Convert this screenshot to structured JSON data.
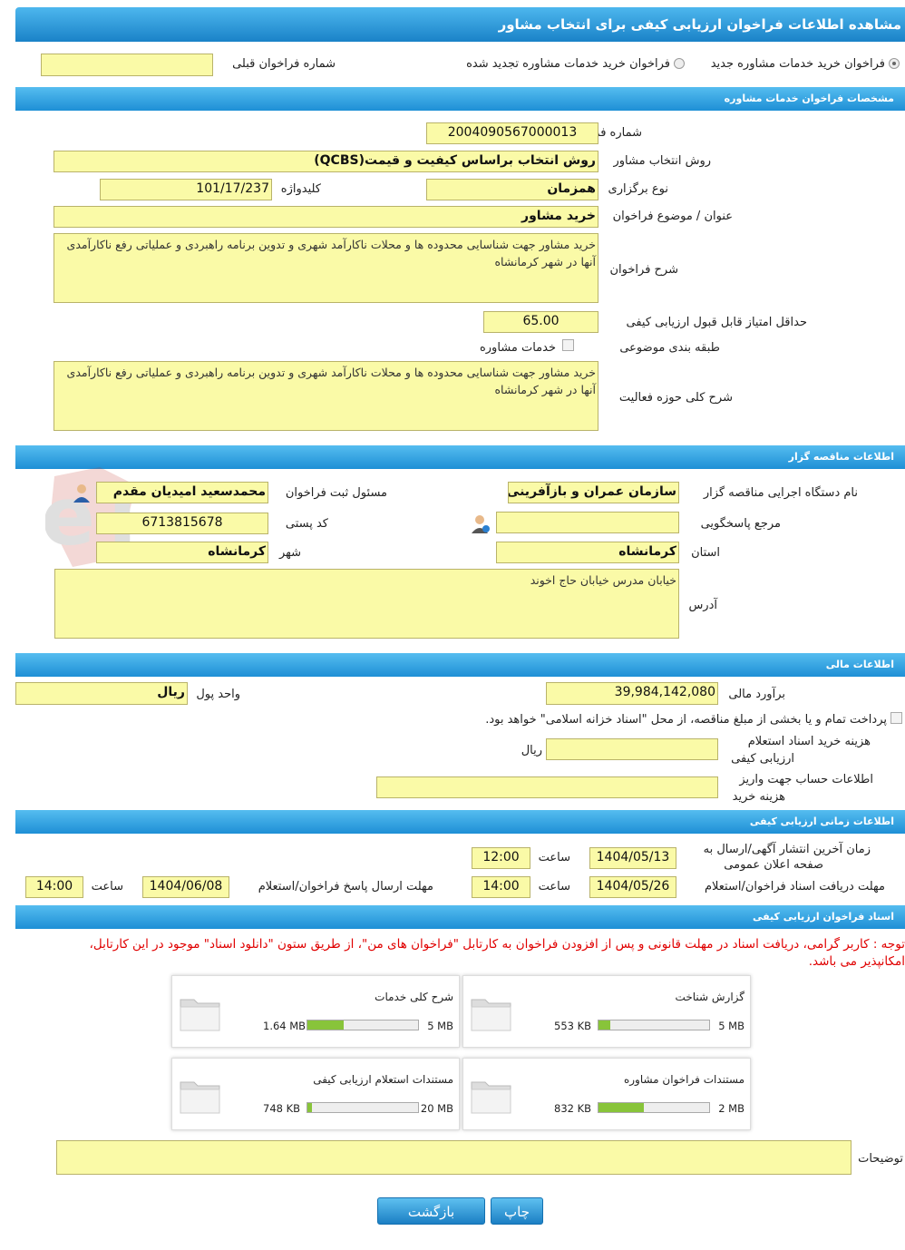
{
  "header": {
    "title": "مشاهده اطلاعات فراخوان ارزیابی کیفی برای انتخاب مشاور"
  },
  "top": {
    "radio1": "فراخوان خرید خدمات مشاوره جدید",
    "radio2": "فراخوان خرید خدمات مشاوره تجدید شده",
    "prev_label": "شماره فراخوان قبلی",
    "prev_value": ""
  },
  "sec1": {
    "title": "مشخصات فراخوان خدمات مشاوره",
    "num_label": "شماره فراخوان",
    "num_value": "2004090567000013",
    "method_label": "روش انتخاب مشاور",
    "method_value": "روش انتخاب براساس کیفیت و قیمت(QCBS)",
    "type_label": "نوع برگزاری",
    "type_value": "همزمان",
    "key_label": "کلیدواژه",
    "key_value": "101/17/237",
    "subject_label": "عنوان / موضوع فراخوان",
    "subject_value": "خرید مشاور",
    "desc_label": "شرح فراخوان",
    "desc_value": "خرید مشاور جهت شناسایی محدوده ها و محلات ناکارآمد شهری و تدوین برنامه راهبردی و عملیاتی رفع ناکارآمدی آنها در شهر کرمانشاه",
    "score_label": "حداقل امتیاز قابل قبول ارزیابی کیفی",
    "score_value": "65.00",
    "cat_label": "طبقه بندی موضوعی",
    "cat_value": "خدمات مشاوره",
    "scope_label": "شرح کلی حوزه فعالیت",
    "scope_value": "خرید مشاور جهت شناسایی محدوده ها و محلات ناکارآمد شهری و تدوین برنامه راهبردی و عملیاتی رفع ناکارآمدی آنها در شهر کرمانشاه"
  },
  "sec2": {
    "title": "اطلاعات مناقصه گزار",
    "org_label": "نام دستگاه اجرایی مناقصه گزار",
    "org_value": "سازمان عمران و بازآفرینی ش",
    "resp_label": "مسئول ثبت فراخوان",
    "resp_value": "محمدسعید امیدیان مقدم",
    "ref_label": "مرجع پاسخگویی",
    "ref_value": "",
    "postal_label": "کد پستی",
    "postal_value": "6713815678",
    "prov_label": "استان",
    "prov_value": "کرمانشاه",
    "city_label": "شهر",
    "city_value": "کرمانشاه",
    "addr_label": "آدرس",
    "addr_value": "خیابان مدرس خیابان حاج اخوند"
  },
  "sec3": {
    "title": "اطلاعات مالی",
    "est_label": "برآورد مالی",
    "est_value": "39,984,142,080",
    "cur_label": "واحد پول",
    "cur_value": "ریال",
    "pay_text": "پرداخت تمام و یا بخشی از مبلغ مناقصه، از محل \"اسناد خزانه اسلامی\" خواهد بود.",
    "fee_label1": "هزینه خرید اسناد استعلام",
    "fee_label2": "ارزیابی کیفی",
    "fee_value": "",
    "fee_unit": "ریال",
    "acc_label1": "اطلاعات حساب جهت واریز",
    "acc_label2": "هزینه خرید",
    "acc_value": ""
  },
  "sec4": {
    "title": "اطلاعات زمانی ارزیابی کیفی",
    "pub_label1": "زمان آخرین انتشار آگهی/ارسال به",
    "pub_label2": "صفحه اعلان عمومی",
    "pub_date": "1404/05/13",
    "time_label": "ساعت",
    "pub_time": "12:00",
    "recv_label": "مهلت دریافت اسناد فراخوان/استعلام",
    "recv_date": "1404/05/26",
    "recv_time": "14:00",
    "send_label": "مهلت ارسال پاسخ فراخوان/استعلام",
    "send_date": "1404/06/08",
    "send_time": "14:00"
  },
  "sec5": {
    "title": "اسناد فراخوان ارزیابی کیفی",
    "note1": "توجه : کاربر گرامی، دریافت اسناد در مهلت قانونی و پس از افزودن فراخوان به کارتابل \"فراخوان های من\"، از طریق ستون \"دانلود اسناد\" موجود در این کارتابل،",
    "note2": "امکانپذیر می باشد.",
    "docs": [
      {
        "title": "گزارش شناخت",
        "size": "553 KB",
        "max": "5 MB",
        "fill": 0.11
      },
      {
        "title": "شرح کلی خدمات",
        "size": "1.64 MB",
        "max": "5 MB",
        "fill": 0.33
      },
      {
        "title": "مستندات فراخوان مشاوره",
        "size": "832 KB",
        "max": "2 MB",
        "fill": 0.41
      },
      {
        "title": "مستندات استعلام ارزیابی کیفی",
        "size": "748 KB",
        "max": "20 MB",
        "fill": 0.04
      }
    ],
    "comments_label": "توضیحات",
    "comments_value": ""
  },
  "buttons": {
    "print": "چاپ",
    "back": "بازگشت"
  },
  "watermark": {
    "text": "AriaTender.neT"
  },
  "colors": {
    "header": "#1e8fd6",
    "field": "#fafaa7",
    "note": "#e00000",
    "progress": "#88c43a"
  }
}
